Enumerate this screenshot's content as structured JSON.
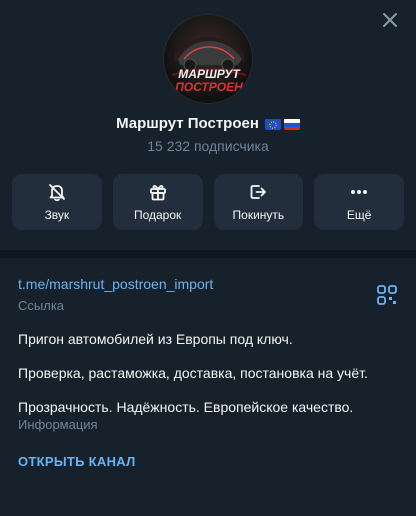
{
  "channel": {
    "name": "Маршрут Построен",
    "subscribers": "15 232 подписчика",
    "avatar_text_line1": "МАРШРУТ",
    "avatar_text_line2": "ПОСТРОЕН",
    "flags": [
      "eu-flag",
      "ru-flag"
    ]
  },
  "actions": [
    {
      "label": "Звук",
      "icon": "bell-slash-icon"
    },
    {
      "label": "Подарок",
      "icon": "gift-icon"
    },
    {
      "label": "Покинуть",
      "icon": "leave-icon"
    },
    {
      "label": "Ещё",
      "icon": "more-icon"
    }
  ],
  "info": {
    "link": "t.me/marshrut_postroen_import",
    "link_caption": "Ссылка",
    "description": [
      "Пригон автомобилей из Европы под ключ.",
      "Проверка, растаможка, доставка, постановка на учёт.",
      "Прозрачность. Надёжность. Европейское качество."
    ],
    "description_caption": "Информация",
    "open_channel": "ОТКРЫТЬ КАНАЛ"
  },
  "colors": {
    "background": "#17212b",
    "button_bg": "#232e3c",
    "accent": "#6ab3f3",
    "muted": "#708499"
  }
}
